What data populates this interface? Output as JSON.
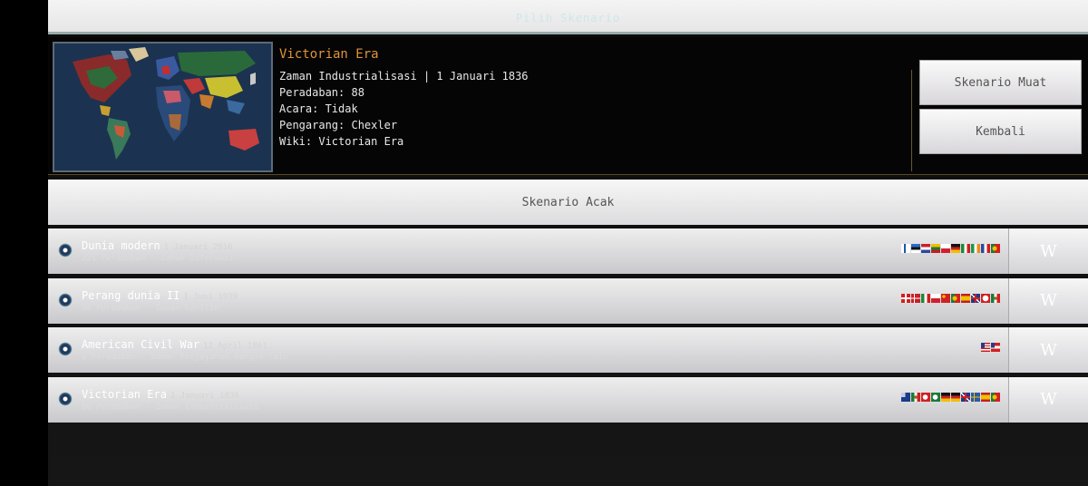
{
  "header": {
    "title": "Pilih Skenario"
  },
  "selected": {
    "name": "Victorian Era",
    "era_date": "Zaman Industrialisasi | 1 Januari 1836",
    "civilizations": "Peradaban: 88",
    "events": "Acara: Tidak",
    "author": "Pengarang: Chexler",
    "wiki": "Wiki: Victorian Era"
  },
  "buttons": {
    "load": "Skenario Muat",
    "back": "Kembali"
  },
  "random": {
    "label": "Skenario Acak"
  },
  "scenarios": [
    {
      "name": "Dunia modern",
      "date": "1 Januari 2016",
      "sub": "221 Peradaban - Zaman Informasi",
      "flags": [
        "finland",
        "estonia",
        "netherlands",
        "lithuania",
        "poland",
        "germany",
        "italy",
        "ireland",
        "france",
        "portugal"
      ]
    },
    {
      "name": "Perang dunia II",
      "date": "1 Juni 1939",
      "sub": "88 Peradaban - Zaman Konflik",
      "flags": [
        "switzerland",
        "denmark",
        "italy",
        "poland",
        "china",
        "portugal",
        "spain",
        "uk",
        "nazi",
        "mexico"
      ]
    },
    {
      "name": "American Civil War",
      "date": "12 April 1861",
      "sub": "3 Peradaban - Zaman Penjajahan Bangsa lain",
      "flags": [
        "usa",
        "confederate"
      ]
    },
    {
      "name": "Victorian Era",
      "date": "1 Januari 1836",
      "sub": "88 Peradaban - Zaman Industrialisasi",
      "flags": [
        "newzealand",
        "mexico",
        "ottoman",
        "ottoman2",
        "germany",
        "germany2",
        "uk",
        "sweden",
        "spain",
        "portugal"
      ]
    }
  ],
  "wiki_glyph": "W",
  "colors": {
    "accent": "#e0943a",
    "panel": "#050505"
  }
}
